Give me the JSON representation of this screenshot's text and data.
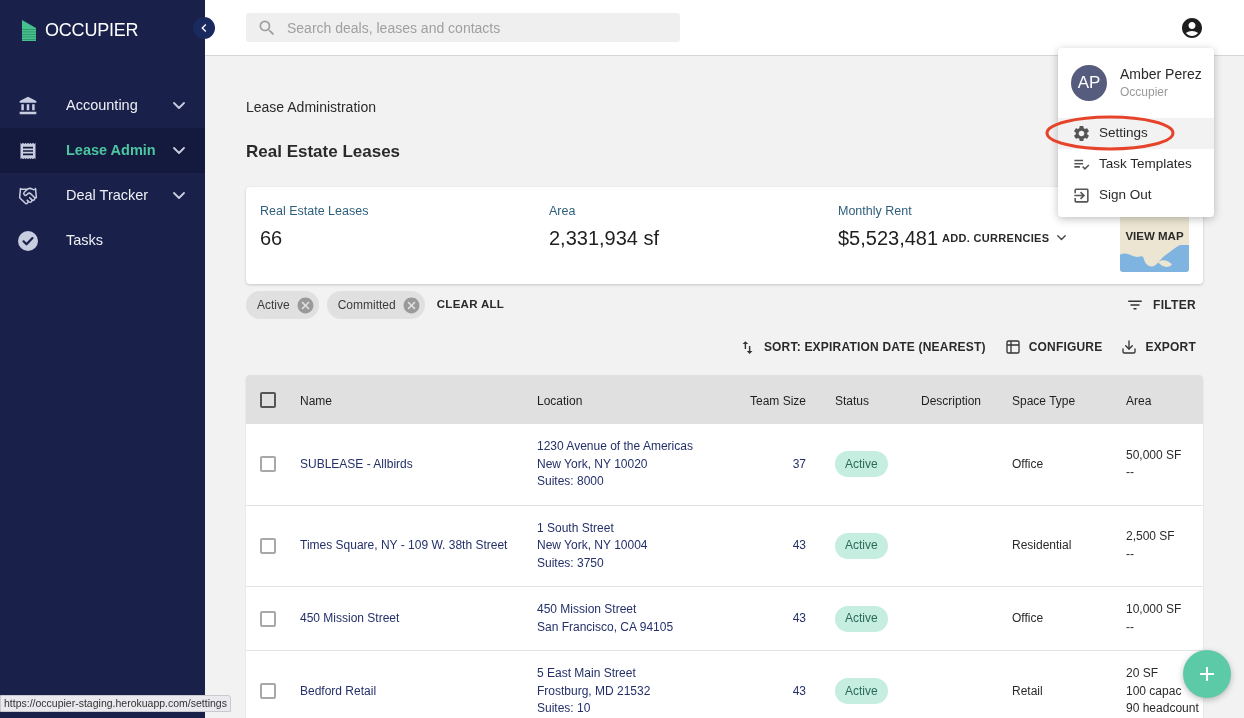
{
  "sidebar": {
    "logo": "OCCUPIER",
    "items": [
      {
        "label": "Accounting",
        "selected": false,
        "expandable": true
      },
      {
        "label": "Lease Admin",
        "selected": true,
        "expandable": true
      },
      {
        "label": "Deal Tracker",
        "selected": false,
        "expandable": true
      },
      {
        "label": "Tasks",
        "selected": false,
        "expandable": false
      }
    ]
  },
  "search": {
    "placeholder": "Search deals, leases and contacts"
  },
  "page": {
    "breadcrumb": "Lease Administration",
    "title": "Real Estate Leases"
  },
  "summary": {
    "stats": [
      {
        "label": "Real Estate Leases",
        "value": "66"
      },
      {
        "label": "Area",
        "value": "2,331,934 sf"
      },
      {
        "label": "Monthly Rent",
        "value": "$5,523,481"
      }
    ],
    "currency_button": "ADD. CURRENCIES",
    "map_button": "VIEW MAP"
  },
  "filters": {
    "chips": [
      {
        "label": "Active"
      },
      {
        "label": "Committed"
      }
    ],
    "clear_all": "CLEAR ALL",
    "filter_button": "FILTER"
  },
  "toolbar": {
    "sort": "SORT: EXPIRATION DATE (NEAREST)",
    "configure": "CONFIGURE",
    "export": "EXPORT"
  },
  "table": {
    "all_checked": false,
    "columns": [
      "Name",
      "Location",
      "Team Size",
      "Status",
      "Description",
      "Space Type",
      "Area"
    ],
    "rows": [
      {
        "checked": false,
        "name": "SUBLEASE - Allbirds",
        "location": [
          "1230 Avenue of the Americas",
          "New York, NY 10020",
          "Suites: 8000"
        ],
        "team_size": "37",
        "status": "Active",
        "space_type": "Office",
        "area": [
          "50,000 SF",
          "--"
        ]
      },
      {
        "checked": false,
        "name": "Times Square, NY - 109 W. 38th Street",
        "location": [
          "1 South Street",
          "New York, NY 10004",
          "Suites: 3750"
        ],
        "team_size": "43",
        "status": "Active",
        "space_type": "Residential",
        "area": [
          "2,500 SF",
          "--"
        ]
      },
      {
        "checked": false,
        "name": "450 Mission Street",
        "location": [
          "450 Mission Street",
          "San Francisco, CA 94105"
        ],
        "team_size": "43",
        "status": "Active",
        "space_type": "Office",
        "area": [
          "10,000 SF",
          "--"
        ]
      },
      {
        "checked": false,
        "name": "Bedford Retail",
        "location": [
          "5 East Main Street",
          "Frostburg, MD 21532",
          "Suites: 10"
        ],
        "team_size": "43",
        "status": "Active",
        "space_type": "Retail",
        "area": [
          "20 SF",
          "100 capac",
          "90 headcount"
        ]
      }
    ]
  },
  "user_menu": {
    "initials": "AP",
    "name": "Amber Perez",
    "organization": "Occupier",
    "items": [
      {
        "label": "Settings",
        "selected": true,
        "circled": true
      },
      {
        "label": "Task Templates",
        "selected": false,
        "circled": false
      },
      {
        "label": "Sign Out",
        "selected": false,
        "circled": false
      }
    ]
  },
  "status_bar": {
    "url": "https://occupier-staging.herokuapp.com/settings"
  }
}
